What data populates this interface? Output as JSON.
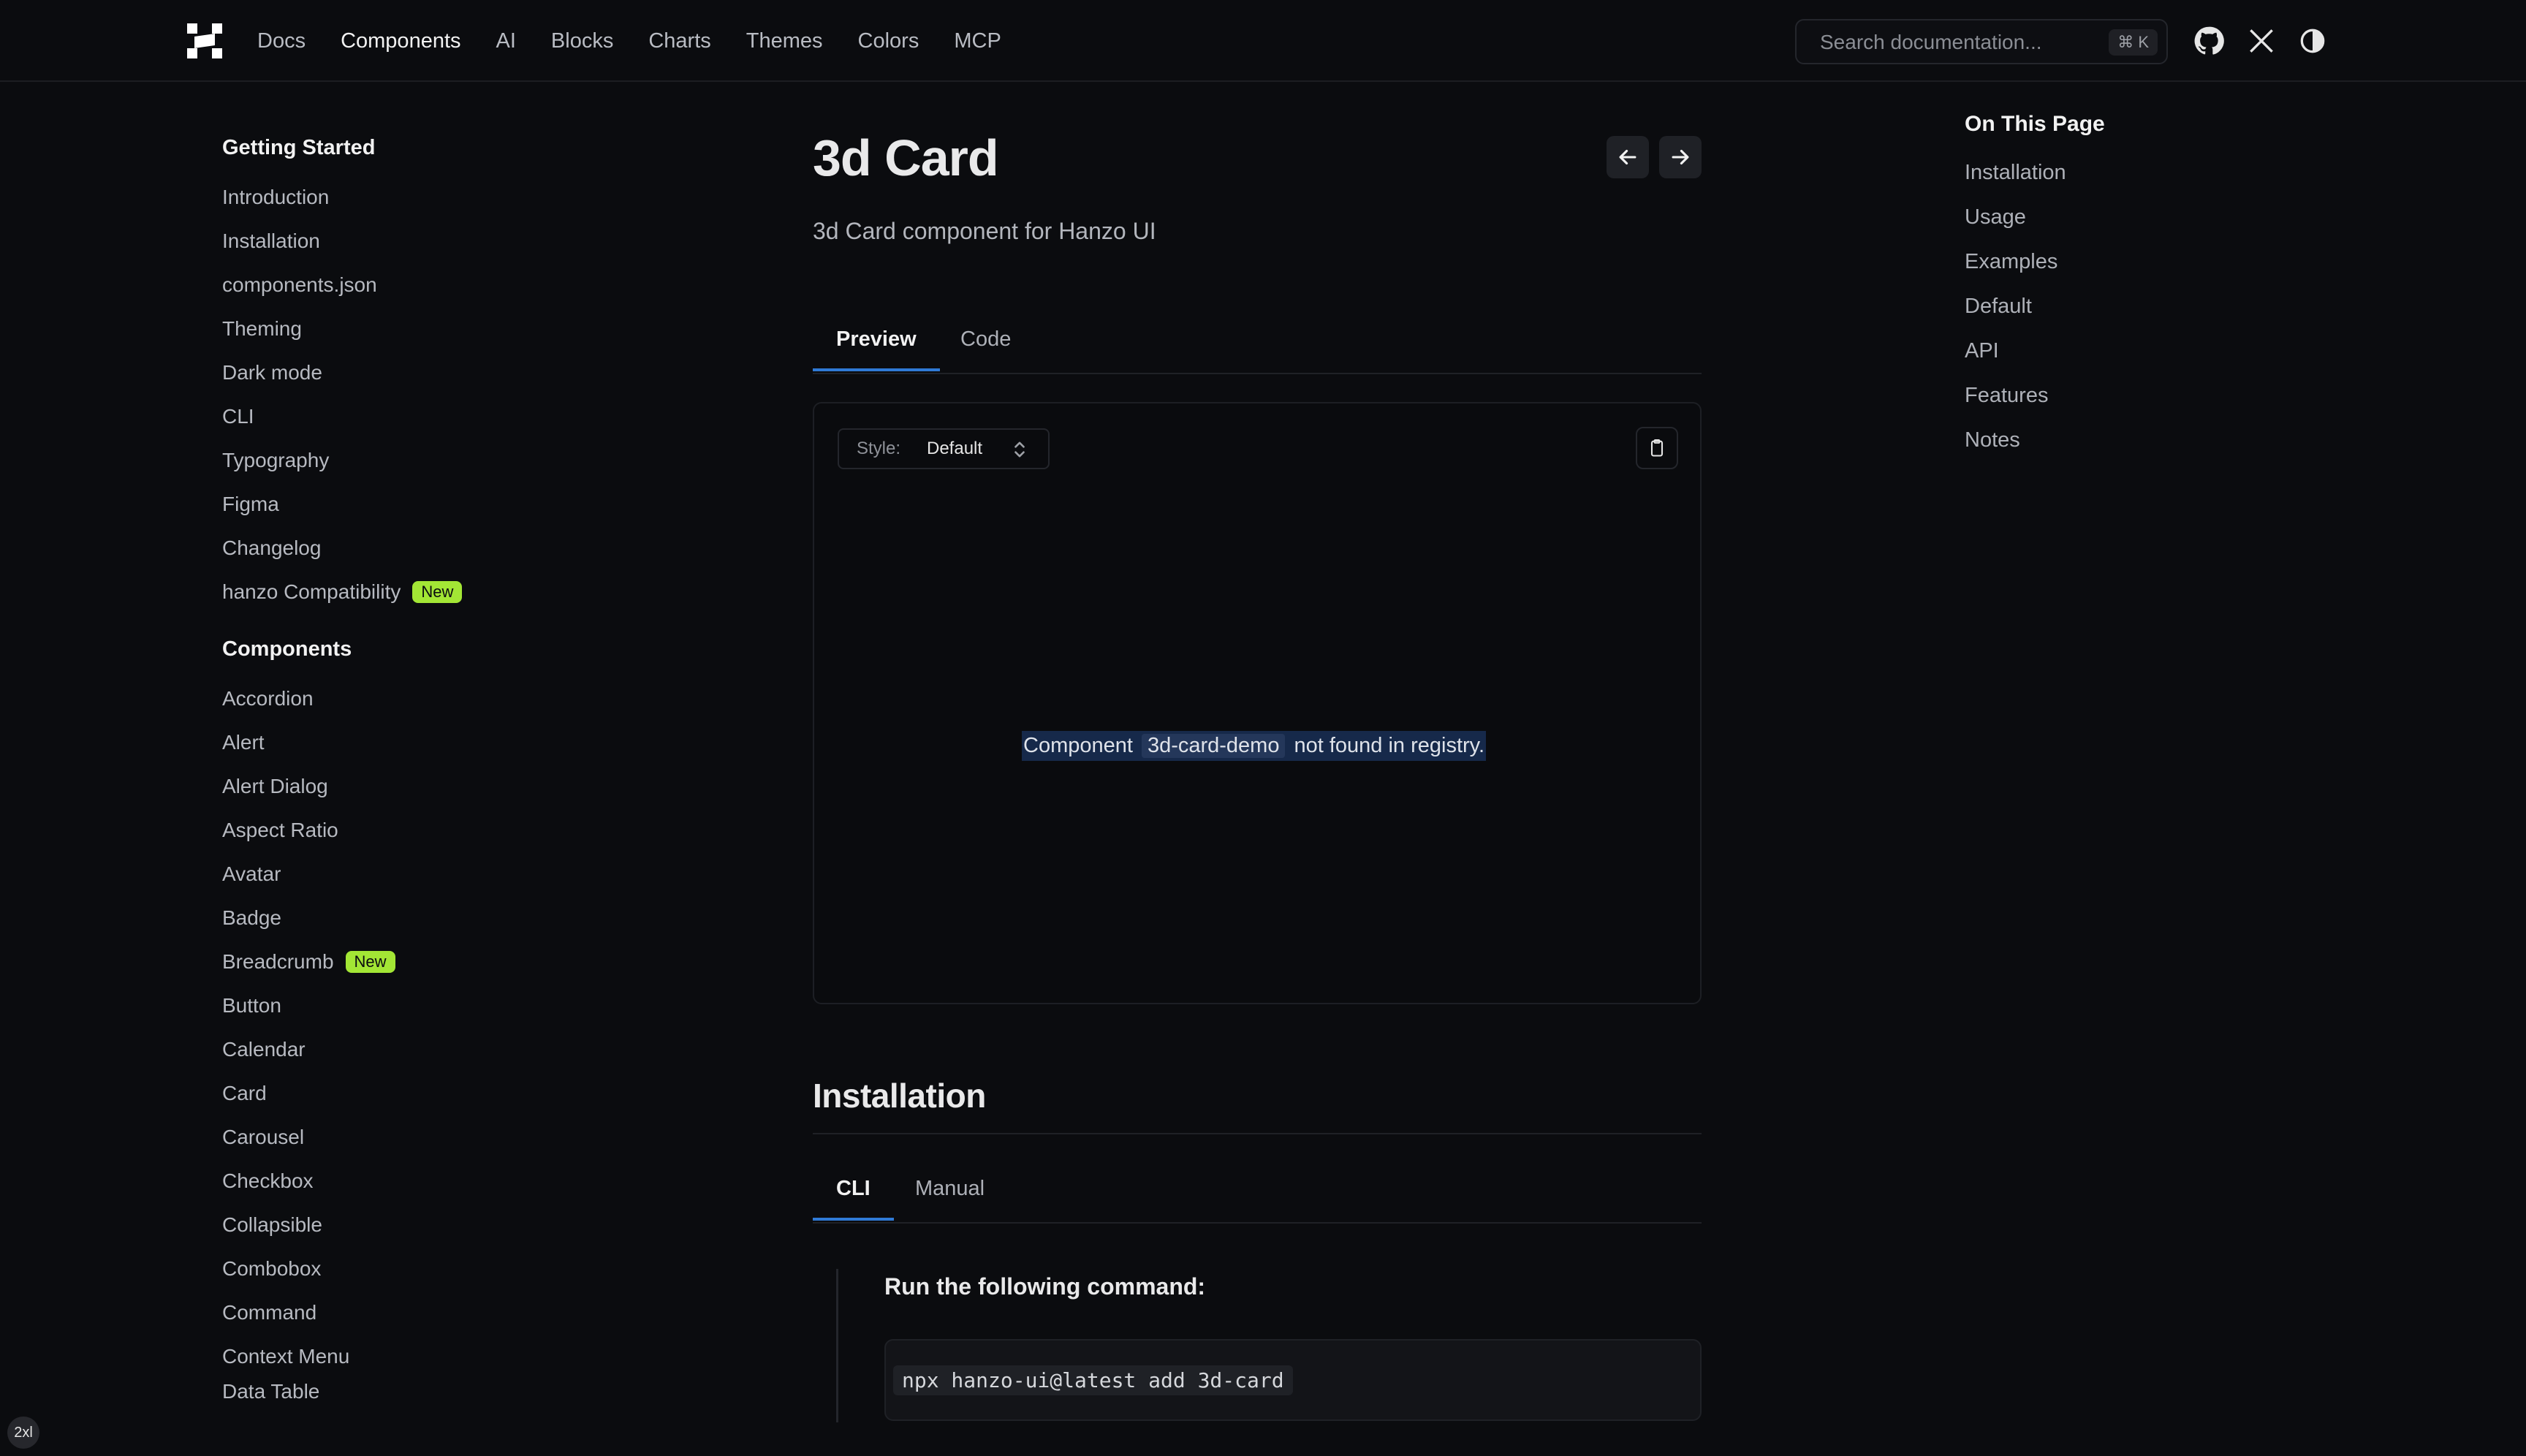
{
  "nav": {
    "items": [
      {
        "label": "Docs"
      },
      {
        "label": "Components",
        "active": true
      },
      {
        "label": "AI"
      },
      {
        "label": "Blocks"
      },
      {
        "label": "Charts"
      },
      {
        "label": "Themes"
      },
      {
        "label": "Colors"
      },
      {
        "label": "MCP"
      }
    ],
    "search_placeholder": "Search documentation...",
    "search_shortcut": "⌘ K",
    "icons": [
      "logo-icon",
      "github-icon",
      "x-icon",
      "theme-toggle-icon"
    ]
  },
  "sidebar": {
    "getting_started": {
      "heading": "Getting Started",
      "items": [
        {
          "label": "Introduction"
        },
        {
          "label": "Installation"
        },
        {
          "label": "components.json"
        },
        {
          "label": "Theming"
        },
        {
          "label": "Dark mode"
        },
        {
          "label": "CLI"
        },
        {
          "label": "Typography"
        },
        {
          "label": "Figma"
        },
        {
          "label": "Changelog"
        },
        {
          "label": "hanzo Compatibility",
          "badge": "New"
        }
      ]
    },
    "components": {
      "heading": "Components",
      "items": [
        {
          "label": "Accordion"
        },
        {
          "label": "Alert"
        },
        {
          "label": "Alert Dialog"
        },
        {
          "label": "Aspect Ratio"
        },
        {
          "label": "Avatar"
        },
        {
          "label": "Badge"
        },
        {
          "label": "Breadcrumb",
          "badge": "New"
        },
        {
          "label": "Button"
        },
        {
          "label": "Calendar"
        },
        {
          "label": "Card"
        },
        {
          "label": "Carousel"
        },
        {
          "label": "Checkbox"
        },
        {
          "label": "Collapsible"
        },
        {
          "label": "Combobox"
        },
        {
          "label": "Command"
        },
        {
          "label": "Context Menu"
        },
        {
          "label": "Data Table"
        }
      ]
    }
  },
  "main": {
    "title": "3d Card",
    "subtitle": "3d Card component for Hanzo UI",
    "tabs": [
      {
        "label": "Preview",
        "active": true
      },
      {
        "label": "Code"
      }
    ],
    "preview": {
      "style_label": "Style:",
      "style_value": "Default",
      "message_prefix": "Component",
      "message_code": "3d-card-demo",
      "message_suffix": "not found in registry."
    },
    "installation": {
      "title": "Installation",
      "tabs": [
        {
          "label": "CLI",
          "active": true
        },
        {
          "label": "Manual"
        }
      ],
      "step_title": "Run the following command:",
      "command": "npx hanzo-ui@latest add 3d-card"
    }
  },
  "toc": {
    "heading": "On This Page",
    "items": [
      {
        "label": "Installation"
      },
      {
        "label": "Usage"
      },
      {
        "label": "Examples"
      },
      {
        "label": "Default"
      },
      {
        "label": "API"
      },
      {
        "label": "Features"
      },
      {
        "label": "Notes"
      }
    ]
  },
  "breakpoint_indicator": "2xl",
  "colors": {
    "background": "#0b0c0f",
    "accent_tab": "#2f7ad6",
    "badge_new": "#a3e635",
    "selection": "#16294a"
  }
}
